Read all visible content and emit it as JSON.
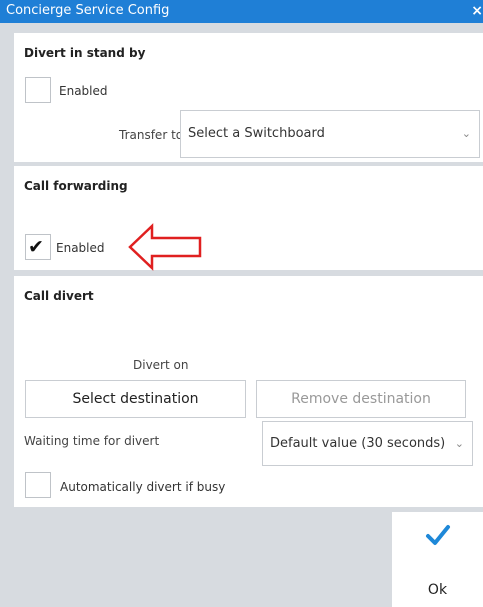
{
  "window": {
    "title": "Concierge Service Config",
    "close_icon": "×"
  },
  "divert_standby": {
    "title": "Divert in stand by",
    "enabled_label": "Enabled",
    "enabled_checked": false,
    "transfer_label": "Transfer to",
    "switchboard_value": "Select a Switchboard"
  },
  "call_forwarding": {
    "title": "Call forwarding",
    "enabled_label": "Enabled",
    "enabled_checked": true
  },
  "call_divert": {
    "title": "Call divert",
    "divert_on_label": "Divert on",
    "select_destination": "Select destination",
    "remove_destination": "Remove destination",
    "waiting_label": "Waiting time for divert",
    "waiting_value": "Default value (30 seconds)",
    "auto_divert_label": "Automatically divert if busy",
    "auto_divert_checked": false
  },
  "footer": {
    "ok_label": "Ok"
  },
  "colors": {
    "title_bar": "#1f7fd6",
    "ok_check": "#1e88d8",
    "annotation_arrow": "#e02020"
  }
}
